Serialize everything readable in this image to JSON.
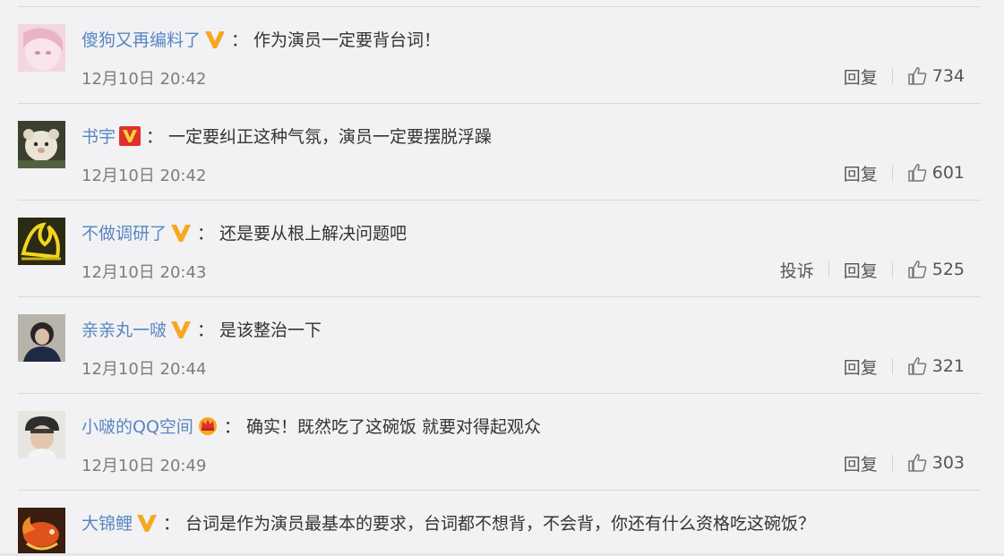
{
  "comments": [
    {
      "username": "傻狗又再编料了",
      "badge": "gold-v",
      "text": "作为演员一定要背台词！",
      "timestamp": "12月10日 20:42",
      "report_label": "",
      "reply_label": "回复",
      "likes": "734"
    },
    {
      "username": "书宇",
      "badge": "red-v",
      "text": "一定要纠正这种气氛，演员一定要摆脱浮躁",
      "timestamp": "12月10日 20:42",
      "report_label": "",
      "reply_label": "回复",
      "likes": "601"
    },
    {
      "username": "不做调研了",
      "badge": "gold-v",
      "text": "还是要从根上解决问题吧",
      "timestamp": "12月10日 20:43",
      "report_label": "投诉",
      "reply_label": "回复",
      "likes": "525"
    },
    {
      "username": "亲亲丸一啵",
      "badge": "gold-v",
      "text": "是该整治一下",
      "timestamp": "12月10日 20:44",
      "report_label": "",
      "reply_label": "回复",
      "likes": "321"
    },
    {
      "username": "小啵的QQ空间",
      "badge": "crown",
      "text": "确实！既然吃了这碗饭 就要对得起观众",
      "timestamp": "12月10日 20:49",
      "report_label": "",
      "reply_label": "回复",
      "likes": "303"
    },
    {
      "username": "大锦鲤",
      "badge": "gold-v",
      "text": "台词是作为演员最基本的要求，台词都不想背，不会背，你还有什么资格吃这碗饭？",
      "timestamp": "",
      "report_label": "",
      "reply_label": "",
      "likes": ""
    }
  ],
  "colors": {
    "username": "#5a86bf",
    "badge_gold": "#f6a821",
    "badge_red": "#e0302c",
    "background": "#f2f2f5"
  },
  "icons": {
    "like": "thumbs-up-icon",
    "gold_badge": "gold-v-badge-icon",
    "red_badge": "red-v-badge-icon",
    "crown_badge": "crown-badge-icon"
  }
}
